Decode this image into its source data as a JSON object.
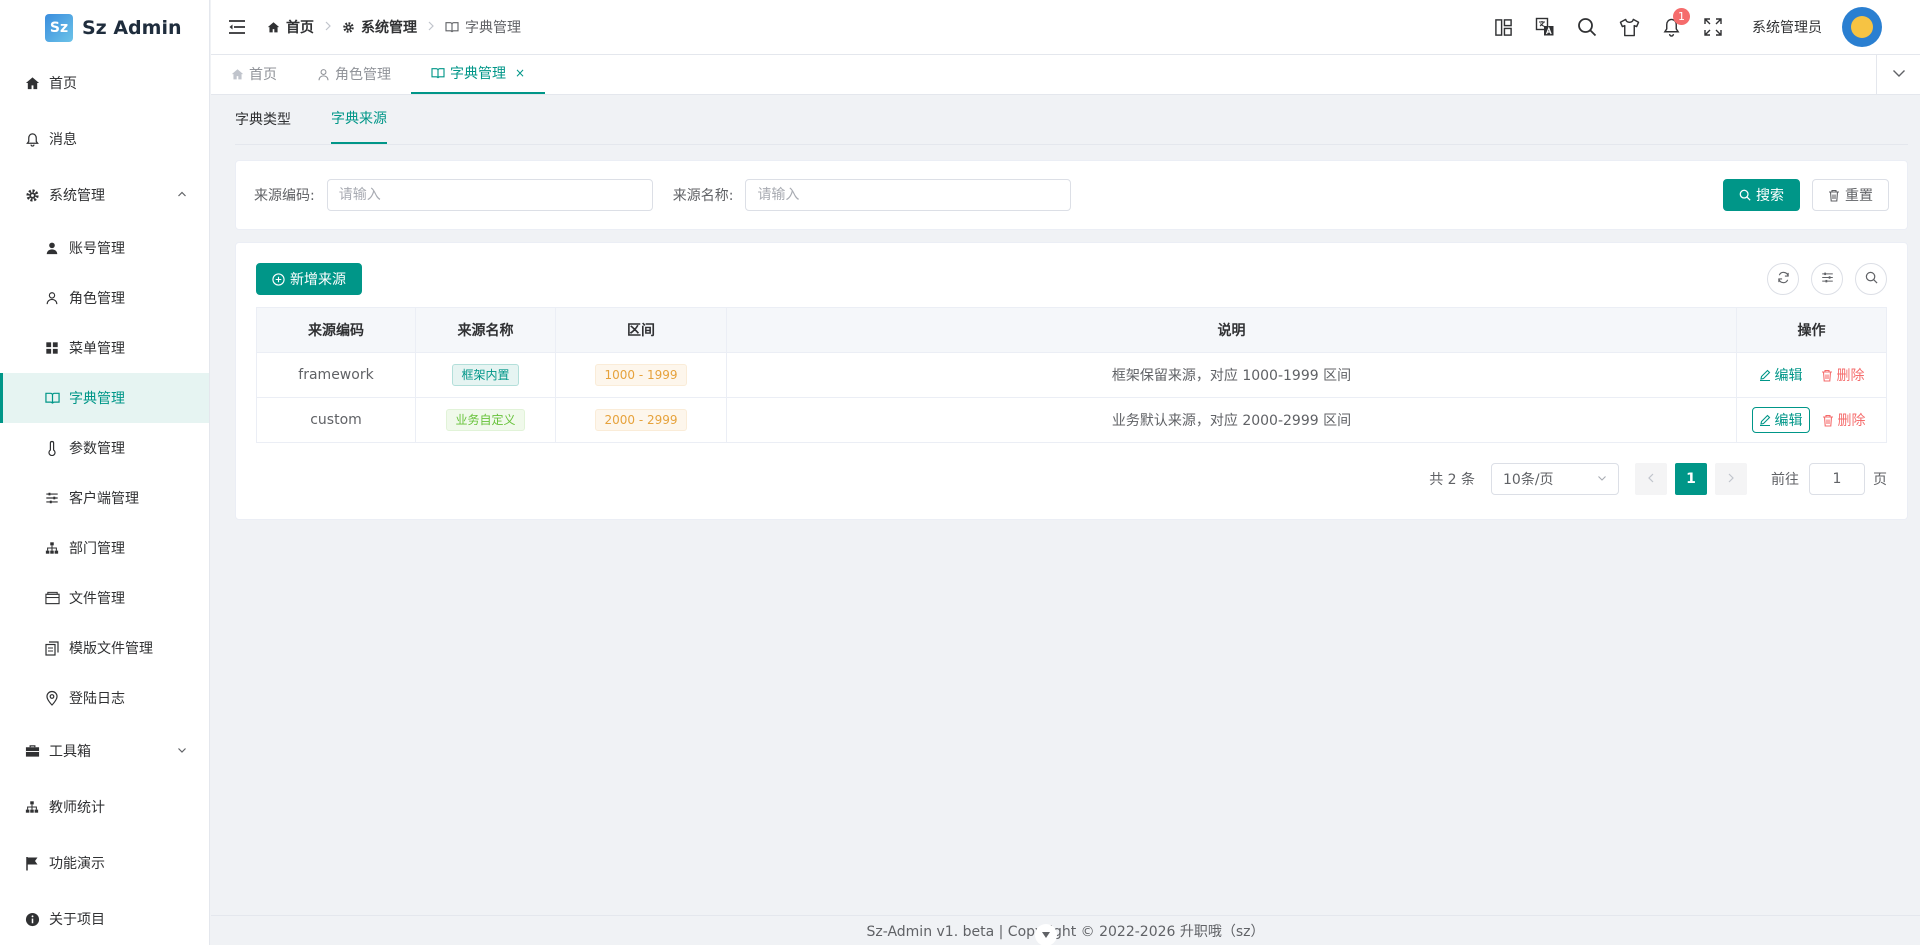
{
  "app": {
    "logo_text": "Sz Admin",
    "logo_mark": "Sz"
  },
  "sidebar": {
    "items": [
      {
        "label": "首页",
        "icon": "home-icon"
      },
      {
        "label": "消息",
        "icon": "bell-icon"
      },
      {
        "label": "系统管理",
        "icon": "gear-icon",
        "expanded": true
      },
      {
        "label": "账号管理",
        "icon": "user-icon"
      },
      {
        "label": "角色管理",
        "icon": "user-outline-icon"
      },
      {
        "label": "菜单管理",
        "icon": "grid-icon"
      },
      {
        "label": "字典管理",
        "icon": "book-icon",
        "active": true
      },
      {
        "label": "参数管理",
        "icon": "thermometer-icon"
      },
      {
        "label": "客户端管理",
        "icon": "sliders-icon"
      },
      {
        "label": "部门管理",
        "icon": "org-chart-icon"
      },
      {
        "label": "文件管理",
        "icon": "folder-icon"
      },
      {
        "label": "模版文件管理",
        "icon": "copy-icon"
      },
      {
        "label": "登陆日志",
        "icon": "location-icon"
      },
      {
        "label": "工具箱",
        "icon": "toolbox-icon"
      },
      {
        "label": "教师统计",
        "icon": "org-chart-icon"
      },
      {
        "label": "功能演示",
        "icon": "flag-icon"
      },
      {
        "label": "关于项目",
        "icon": "info-icon"
      }
    ]
  },
  "header": {
    "breadcrumb": [
      "首页",
      "系统管理",
      "字典管理"
    ],
    "username": "系统管理员",
    "notification_count": "1"
  },
  "tabs": [
    {
      "label": "首页"
    },
    {
      "label": "角色管理"
    },
    {
      "label": "字典管理",
      "active": true,
      "close": "×"
    }
  ],
  "sub_tabs": [
    {
      "label": "字典类型"
    },
    {
      "label": "字典来源",
      "active": true
    }
  ],
  "search": {
    "code_label": "来源编码:",
    "code_placeholder": "请输入",
    "name_label": "来源名称:",
    "name_placeholder": "请输入",
    "search_button": "搜索",
    "reset_button": "重置"
  },
  "toolbar": {
    "add_button": "新增来源"
  },
  "table": {
    "columns": [
      "来源编码",
      "来源名称",
      "区间",
      "说明",
      "操作"
    ],
    "rows": [
      {
        "code": "framework",
        "name": "框架内置",
        "range": "1000 - 1999",
        "desc": "框架保留来源，对应 1000-1999 区间"
      },
      {
        "code": "custom",
        "name": "业务自定义",
        "range": "2000 - 2999",
        "desc": "业务默认来源，对应 2000-2999 区间"
      }
    ],
    "edit_label": "编辑",
    "delete_label": "删除"
  },
  "pagination": {
    "total": "共 2 条",
    "page_size": "10条/页",
    "current_page": "1",
    "goto_prefix": "前往",
    "goto_value": "1",
    "goto_suffix": "页"
  },
  "footer": {
    "text": "Sz-Admin v1.    beta | Copyright © 2022-2026 升职哦（sz）"
  },
  "colors": {
    "primary": "#009688",
    "danger": "#f56c6c",
    "warning": "#e6a23c",
    "success": "#67c23a"
  }
}
